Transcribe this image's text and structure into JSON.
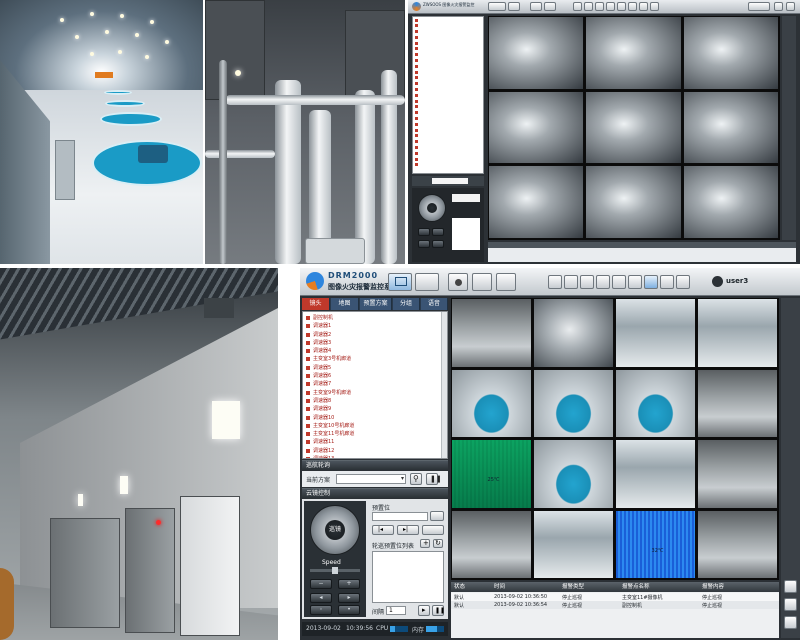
{
  "top_app": {
    "title": "ZWSOOS 图像火灾报警监控",
    "tree_items": [
      "",
      "",
      "",
      "",
      "",
      "",
      "",
      "",
      "",
      "",
      "",
      "",
      "",
      "",
      "",
      "",
      "",
      "",
      "",
      "",
      "",
      "",
      "",
      "",
      "",
      ""
    ]
  },
  "bottom_app": {
    "logo_text": "DRM2000",
    "app_title": "图像火灾报警监控系统",
    "user": "user3",
    "tabs": [
      "镜头",
      "地图",
      "预置方案",
      "分组",
      "语音"
    ],
    "tree_items": [
      "副控制机",
      "调速器1",
      "调速器2",
      "调速器3",
      "调速器4",
      "主变室3号机廊道",
      "调速器5",
      "调速器6",
      "调速器7",
      "主变室9号机廊道",
      "调速器8",
      "调速器9",
      "调速器10",
      "主变室10号机廊道",
      "主变室11号机廊道",
      "调速器11",
      "调速器12",
      "调速器13",
      "调速器14",
      "调速器15",
      "调速器16"
    ],
    "rotation_section": "巡航轮询",
    "current_scheme_label": "当前方案",
    "ptz_section": "云镜控制",
    "preset_label": "预置位",
    "ptz_center_label": "巡镜",
    "speed_label": "Speed",
    "preset_list_label": "轮巡预置位列表",
    "interval_label": "间隔",
    "interval_value": "1",
    "date": "2013-09-02",
    "time": "10:39:56",
    "cpu_label": "CPU",
    "mem_label": "内存",
    "overlay_temp_1": "25℃",
    "overlay_temp_2": "32℃",
    "table": {
      "headers": [
        "状态",
        "时间",
        "报警类型",
        "报警点名称",
        "报警内容"
      ],
      "rows": [
        [
          "默认",
          "2013-09-02 10:36:50",
          "停止巡视",
          "主变室11#摄像机",
          "停止巡视"
        ],
        [
          "默认",
          "2013-09-02 10:36:54",
          "停止巡视",
          "副控制机",
          "停止巡视"
        ]
      ]
    }
  },
  "colors": {
    "accent_red": "#c0392b",
    "tab_blue": "#3a5474",
    "pool_blue": "#1a9bc6",
    "thermal_green": "#37c79a",
    "thermal_blue": "#2c8af0"
  }
}
